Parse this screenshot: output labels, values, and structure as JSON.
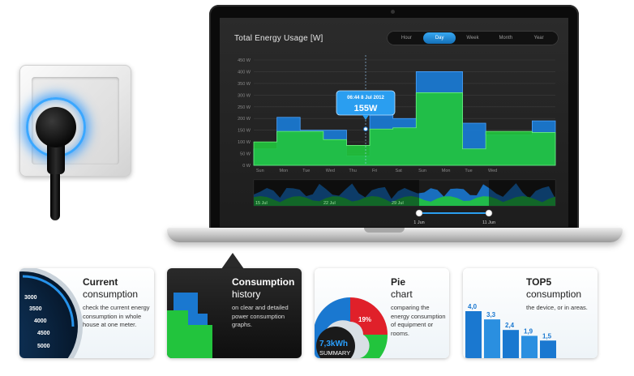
{
  "app": {
    "title": "Total Energy Usage [W]",
    "periods": [
      {
        "label": "Hour",
        "active": false
      },
      {
        "label": "Day",
        "active": true
      },
      {
        "label": "Week",
        "active": false
      },
      {
        "label": "Month",
        "active": false
      },
      {
        "label": "Year",
        "active": false
      }
    ]
  },
  "chart_data": {
    "type": "area",
    "ylim": [
      0,
      450
    ],
    "y_ticks": [
      "450 W",
      "400 W",
      "350 W",
      "300 W",
      "250 W",
      "200 W",
      "150 W",
      "100 W",
      "50 W",
      "0 W"
    ],
    "categories": [
      "Sun",
      "Mon",
      "Tue",
      "Wed",
      "Thu",
      "Fri",
      "Sat",
      "Sun",
      "Mon",
      "Tue",
      "Wed"
    ],
    "series": [
      {
        "color": "#1a78d0",
        "values": [
          70,
          205,
          150,
          150,
          40,
          220,
          200,
          400,
          400,
          180,
          130,
          130,
          190
        ]
      },
      {
        "color": "#22c43d",
        "values": [
          100,
          145,
          145,
          110,
          85,
          155,
          160,
          310,
          310,
          70,
          145,
          145,
          140
        ]
      }
    ],
    "tooltip": {
      "time": "06:44 8 Jul 2012",
      "value": "155W"
    },
    "navigator": {
      "labels": [
        "15 Jul",
        "22 Jul",
        "29 Jul"
      ],
      "range_start": "1 Jun",
      "range_end": "11 Jun"
    }
  },
  "cards": [
    {
      "title": "Current",
      "subtitle": "consumption",
      "desc": "check the current energy consumption in whole house at one meter.",
      "gauge": [
        "3000",
        "3500",
        "4000",
        "4500",
        "5000"
      ]
    },
    {
      "title": "Consumption",
      "subtitle": "history",
      "desc": "on clear and detailed power consumption graphs."
    },
    {
      "title": "Pie",
      "subtitle": "chart",
      "desc": "comparing the energy consumption of equipment or rooms.",
      "pie_value": "19%",
      "summary_value": "7,3kWh",
      "summary_label": "SUMMARY"
    },
    {
      "title": "TOP5",
      "subtitle": "consumption",
      "desc": "the device, or in areas.",
      "bars": [
        "4,0",
        "3,3",
        "2,4",
        "1,9",
        "1,5"
      ],
      "bar_values": [
        4.0,
        3.3,
        2.4,
        1.9,
        1.5
      ]
    }
  ],
  "colors": {
    "accent_blue": "#1a78d0",
    "accent_green": "#22c43d",
    "pie_red": "#e0202a"
  }
}
